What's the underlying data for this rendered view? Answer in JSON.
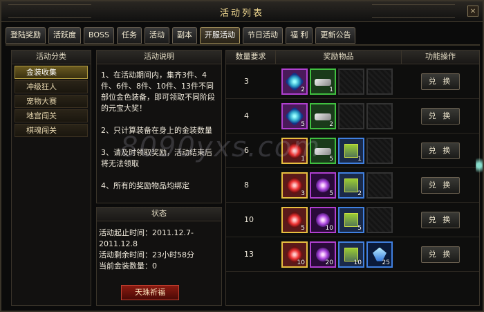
{
  "window": {
    "title": "活动列表",
    "close": "×"
  },
  "tabs": [
    {
      "label": "登陆奖励"
    },
    {
      "label": "活跃度"
    },
    {
      "label": "BOSS"
    },
    {
      "label": "任务"
    },
    {
      "label": "活动"
    },
    {
      "label": "副本"
    },
    {
      "label": "开服活动",
      "active": true
    },
    {
      "label": "节日活动"
    },
    {
      "label": "福 利"
    },
    {
      "label": "更新公告"
    }
  ],
  "category": {
    "header": "活动分类",
    "items": [
      {
        "label": "金装收集",
        "selected": true
      },
      {
        "label": "冲级狂人"
      },
      {
        "label": "宠物大赛"
      },
      {
        "label": "地宫闯关"
      },
      {
        "label": "棋魂闯关"
      }
    ]
  },
  "description": {
    "header": "活动说明",
    "paragraphs": [
      "1、在活动期间内，集齐3件、4件、6件、8件、10件、13件不同部位金色装备，即可领取不同阶段的元宝大奖！",
      "2、只计算装备在身上的金装数量",
      "3、请及时领取奖励，活动结束后将无法领取",
      "4、所有的奖励物品均绑定"
    ]
  },
  "status": {
    "header": "状态",
    "start_label": "活动起止时间：2011.12.7-2011.12.8",
    "remaining_label": "活动剩余时间：23小时58分",
    "count_label": "当前金装数量：0",
    "bless_button": "天珠祈福"
  },
  "table": {
    "headers": [
      "数量要求",
      "奖励物品",
      "功能操作"
    ],
    "rows": [
      {
        "qty": "3",
        "items": [
          {
            "icon": "blue-gem-icon",
            "type": "gem",
            "count": "2"
          },
          {
            "icon": "key-icon",
            "type": "key",
            "count": "1"
          }
        ],
        "button": "兑 换"
      },
      {
        "qty": "4",
        "items": [
          {
            "icon": "blue-gem-icon",
            "type": "gem",
            "count": "5"
          },
          {
            "icon": "key-icon",
            "type": "key",
            "count": "2"
          }
        ],
        "button": "兑 换"
      },
      {
        "qty": "6",
        "items": [
          {
            "icon": "ruby-icon",
            "type": "ruby",
            "count": "1"
          },
          {
            "icon": "key-icon",
            "type": "key",
            "count": "5"
          },
          {
            "icon": "scroll-icon",
            "type": "scroll",
            "count": "1"
          }
        ],
        "button": "兑 换"
      },
      {
        "qty": "8",
        "items": [
          {
            "icon": "ruby-icon",
            "type": "ruby",
            "count": "3"
          },
          {
            "icon": "rune-icon",
            "type": "rune",
            "count": "5"
          },
          {
            "icon": "scroll-icon",
            "type": "scroll",
            "count": "2"
          }
        ],
        "button": "兑 换"
      },
      {
        "qty": "10",
        "items": [
          {
            "icon": "ruby-icon",
            "type": "ruby",
            "count": "5"
          },
          {
            "icon": "rune-icon",
            "type": "rune",
            "count": "10"
          },
          {
            "icon": "scroll-icon",
            "type": "scroll",
            "count": "5"
          }
        ],
        "button": "兑 换"
      },
      {
        "qty": "13",
        "items": [
          {
            "icon": "ruby-icon",
            "type": "ruby",
            "count": "10"
          },
          {
            "icon": "rune-icon",
            "type": "rune",
            "count": "20"
          },
          {
            "icon": "scroll-icon",
            "type": "scroll",
            "count": "10"
          },
          {
            "icon": "crystal-icon",
            "type": "crystal",
            "count": "25"
          }
        ],
        "button": "兑 换"
      }
    ]
  },
  "watermark": "8090yxs.com"
}
